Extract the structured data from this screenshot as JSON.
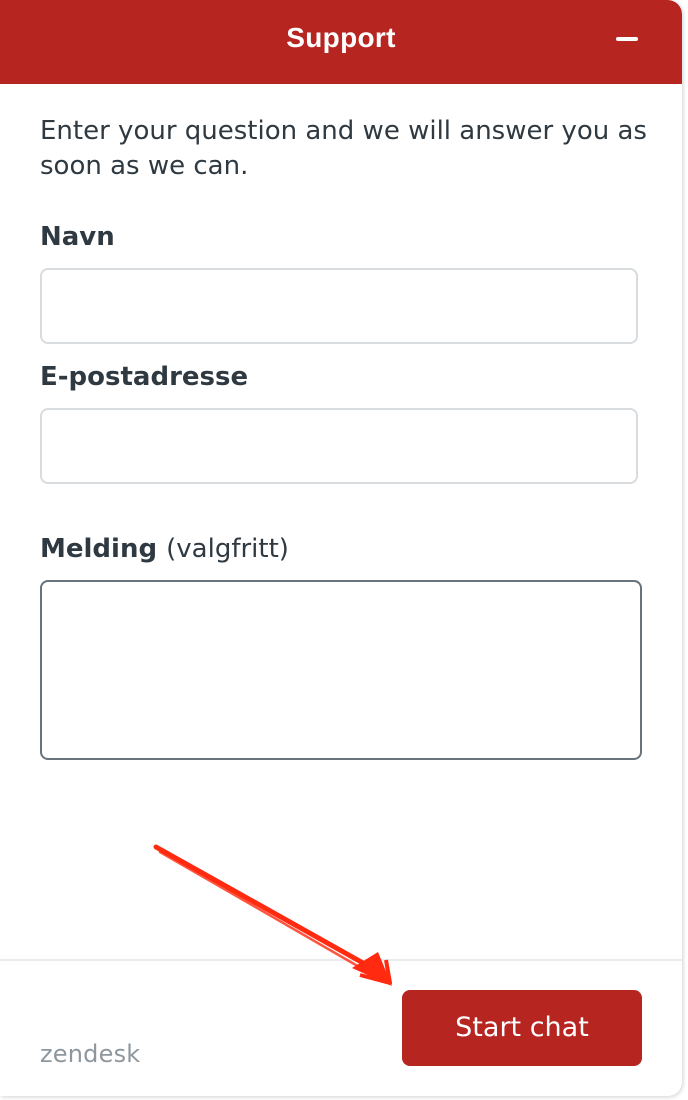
{
  "header": {
    "title": "Support",
    "minimize_icon": "minus-icon",
    "background_color": "#b72520"
  },
  "form": {
    "intro": "Enter your question and we will answer you as soon as we can.",
    "name_label": "Navn",
    "name_value": "",
    "email_label": "E-postadresse",
    "email_value": "",
    "message_label": "Melding",
    "message_optional": "(valgfritt)",
    "message_value": ""
  },
  "footer": {
    "logo_text": "zendesk",
    "start_chat_label": "Start chat",
    "button_color": "#b72520"
  },
  "annotation": {
    "arrow_color": "#ff2a10",
    "arrow_icon": "red-arrow-pointing-to-start-chat"
  }
}
